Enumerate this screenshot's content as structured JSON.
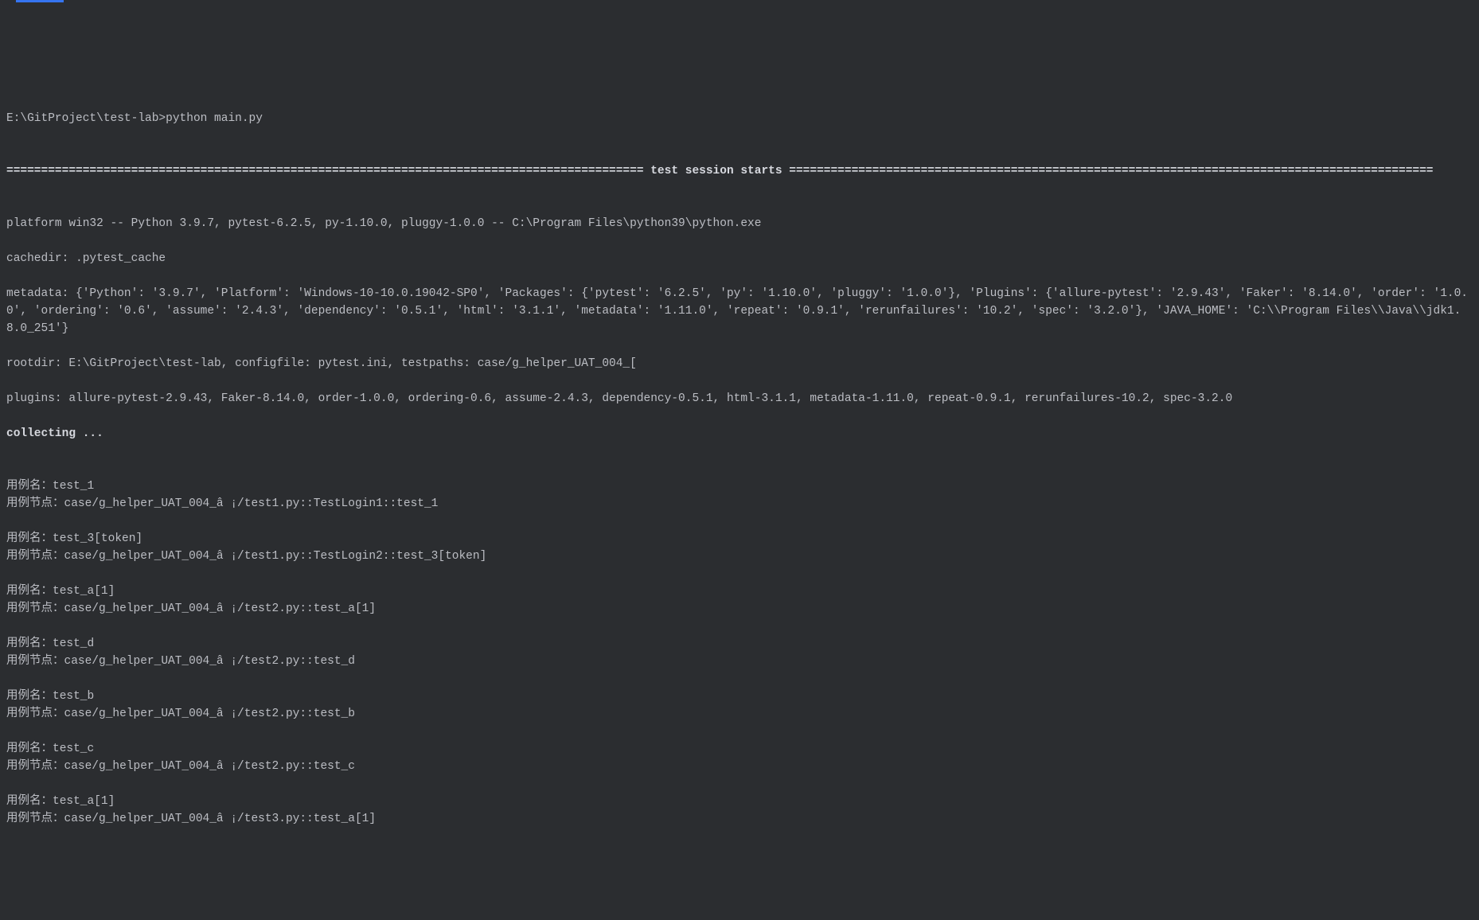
{
  "prompt": "E:\\GitProject\\test-lab>python main.py",
  "session_banner_left": "============================================================================================ ",
  "session_banner_title": "test session starts",
  "session_banner_right": " =============================================================================================",
  "platform_line": "platform win32 -- Python 3.9.7, pytest-6.2.5, py-1.10.0, pluggy-1.0.0 -- C:\\Program Files\\python39\\python.exe",
  "cachedir_line": "cachedir: .pytest_cache",
  "metadata_line": "metadata: {'Python': '3.9.7', 'Platform': 'Windows-10-10.0.19042-SP0', 'Packages': {'pytest': '6.2.5', 'py': '1.10.0', 'pluggy': '1.0.0'}, 'Plugins': {'allure-pytest': '2.9.43', 'Faker': '8.14.0', 'order': '1.0.0', 'ordering': '0.6', 'assume': '2.4.3', 'dependency': '0.5.1', 'html': '3.1.1', 'metadata': '1.11.0', 'repeat': '0.9.1', 'rerunfailures': '10.2', 'spec': '3.2.0'}, 'JAVA_HOME': 'C:\\\\Program Files\\\\Java\\\\jdk1.8.0_251'}",
  "rootdir_line": "rootdir: E:\\GitProject\\test-lab, configfile: pytest.ini, testpaths: case/g_helper_UAT_004_[",
  "plugins_line": "plugins: allure-pytest-2.9.43, Faker-8.14.0, order-1.0.0, ordering-0.6, assume-2.4.3, dependency-0.5.1, html-3.1.1, metadata-1.11.0, repeat-0.9.1, rerunfailures-10.2, spec-3.2.0",
  "collecting_line": "collecting ...",
  "labels": {
    "case_name": "用例名：",
    "case_node": "用例节点："
  },
  "cases": [
    {
      "name": "test_1",
      "node": "case/g_helper_UAT_004_â ¡/test1.py::TestLogin1::test_1"
    },
    {
      "name": "test_3[token]",
      "node": "case/g_helper_UAT_004_â ¡/test1.py::TestLogin2::test_3[token]"
    },
    {
      "name": "test_a[1]",
      "node": "case/g_helper_UAT_004_â ¡/test2.py::test_a[1]"
    },
    {
      "name": "test_d",
      "node": "case/g_helper_UAT_004_â ¡/test2.py::test_d"
    },
    {
      "name": "test_b",
      "node": "case/g_helper_UAT_004_â ¡/test2.py::test_b"
    },
    {
      "name": "test_c",
      "node": "case/g_helper_UAT_004_â ¡/test2.py::test_c"
    },
    {
      "name": "test_a[1]",
      "node": "case/g_helper_UAT_004_â ¡/test3.py::test_a[1]"
    }
  ]
}
